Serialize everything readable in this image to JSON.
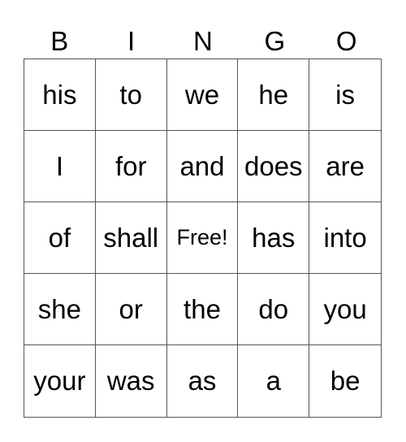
{
  "header": [
    "B",
    "I",
    "N",
    "G",
    "O"
  ],
  "cells": [
    [
      "his",
      "to",
      "we",
      "he",
      "is"
    ],
    [
      "I",
      "for",
      "and",
      "does",
      "are"
    ],
    [
      "of",
      "shall",
      "Free!",
      "has",
      "into"
    ],
    [
      "she",
      "or",
      "the",
      "do",
      "you"
    ],
    [
      "your",
      "was",
      "as",
      "a",
      "be"
    ]
  ]
}
